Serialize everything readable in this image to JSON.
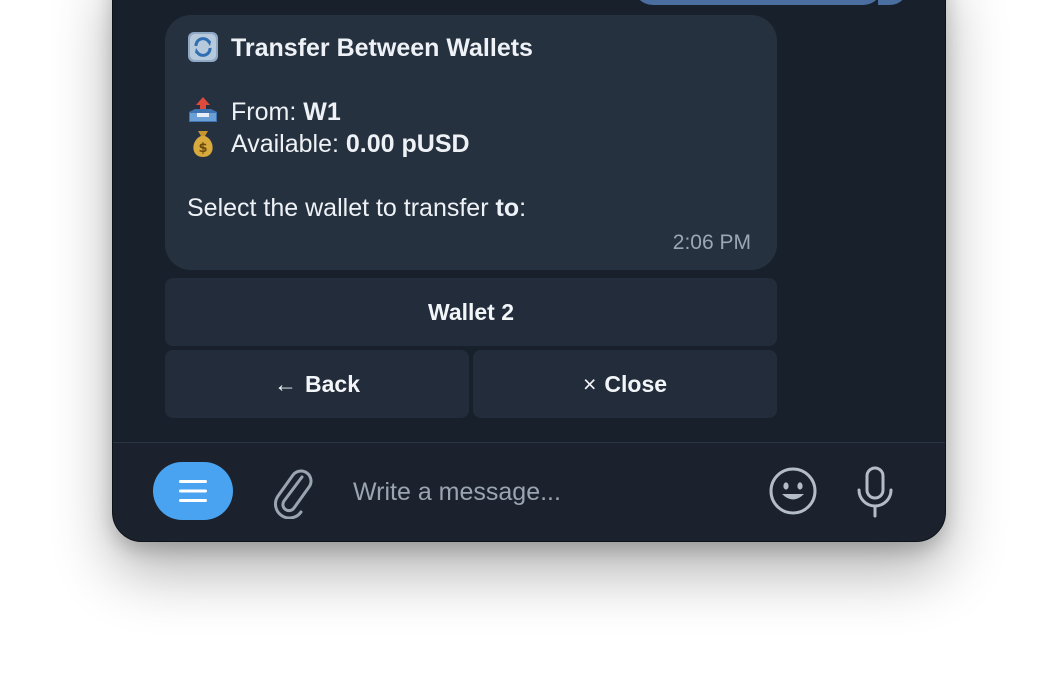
{
  "message": {
    "title_emoji": "arrows-counterclockwise-icon",
    "title": "Transfer Between Wallets",
    "from_emoji": "outbox-tray-icon",
    "from_label": "From:",
    "from_value": "W1",
    "available_emoji": "money-bag-icon",
    "available_label": "Available:",
    "available_value": "0.00 pUSD",
    "select_prefix": "Select the wallet to transfer",
    "select_bold": "to",
    "select_suffix": ":",
    "time": "2:06 PM"
  },
  "keyboard": {
    "wallet2": "Wallet 2",
    "back_glyph": "←",
    "back": "Back",
    "close_glyph": "×",
    "close": "Close"
  },
  "composer": {
    "placeholder": "Write a message...",
    "menu_icon": "menu-icon",
    "attach_icon": "paperclip-icon",
    "emoji_icon": "smiley-icon",
    "mic_icon": "microphone-icon"
  },
  "colors": {
    "window_bg": "#18202c",
    "bubble_bg": "#26313f",
    "button_bg": "#222c3a",
    "accent": "#4aa3f0",
    "outgoing_bubble": "#4a6ea0"
  }
}
